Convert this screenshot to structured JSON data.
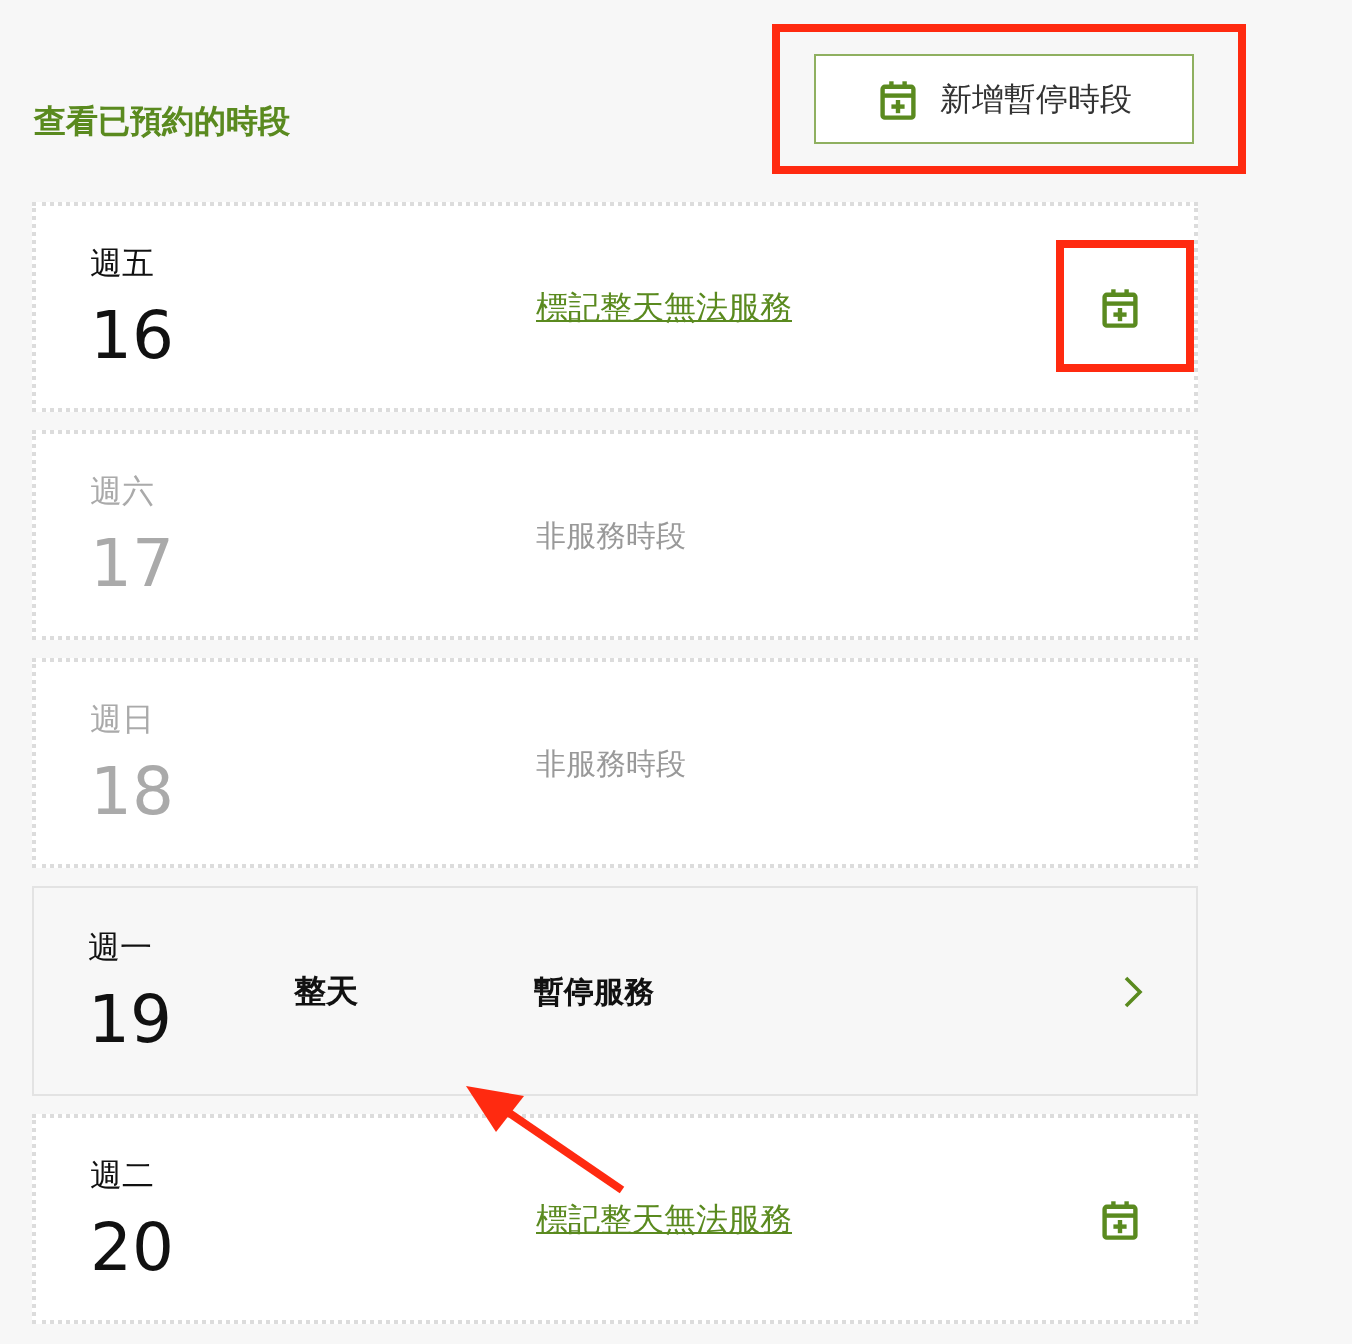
{
  "title": "查看已預約的時段",
  "add_button": {
    "label": "新增暫停時段"
  },
  "days": [
    {
      "kind": "available",
      "weekday": "週五",
      "date": "16",
      "action": "標記整天無法服務"
    },
    {
      "kind": "off",
      "weekday": "週六",
      "date": "17",
      "status": "非服務時段"
    },
    {
      "kind": "off",
      "weekday": "週日",
      "date": "18",
      "status": "非服務時段"
    },
    {
      "kind": "paused",
      "weekday": "週一",
      "date": "19",
      "time": "整天",
      "status": "暫停服務"
    },
    {
      "kind": "available",
      "weekday": "週二",
      "date": "20",
      "action": "標記整天無法服務"
    }
  ]
}
